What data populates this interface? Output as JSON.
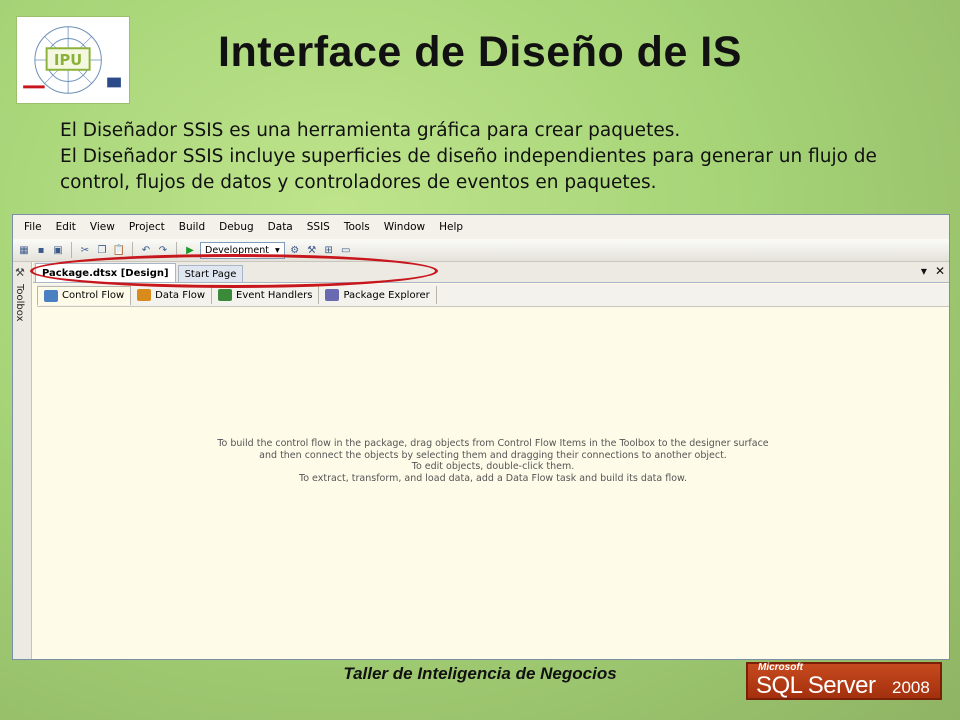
{
  "slide": {
    "title": "Interface de Diseño de IS",
    "description": [
      "El Diseñador SSIS es una herramienta gráfica para crear paquetes.",
      "El Diseñador SSIS incluye superficies de diseño independientes para generar un flujo de control, flujos de datos y controladores de eventos en paquetes."
    ],
    "footer": "Taller de Inteligencia de Negocios",
    "logo_text": "IPU"
  },
  "menu": [
    "File",
    "Edit",
    "View",
    "Project",
    "Build",
    "Debug",
    "Data",
    "SSIS",
    "Tools",
    "Window",
    "Help"
  ],
  "toolbar": {
    "configuration": "Development",
    "icons": [
      "new-project-icon",
      "save-icon",
      "save-all-icon",
      "cut-icon",
      "copy-icon",
      "paste-icon",
      "undo-icon",
      "redo-icon",
      "start-icon",
      "properties-icon",
      "toolbox-icon",
      "object-browser-icon",
      "command-window-icon"
    ]
  },
  "toolbox": {
    "label": "Toolbox"
  },
  "doc_tabs": [
    {
      "label": "Package.dtsx [Design]",
      "active": true
    },
    {
      "label": "Start Page",
      "active": false
    }
  ],
  "designer_tabs": [
    {
      "label": "Control Flow",
      "active": true,
      "color": "#4a7fc1"
    },
    {
      "label": "Data Flow",
      "active": false,
      "color": "#d98a1c"
    },
    {
      "label": "Event Handlers",
      "active": false,
      "color": "#3a8a3a"
    },
    {
      "label": "Package Explorer",
      "active": false,
      "color": "#6a6ab0"
    }
  ],
  "surface_hint": [
    "To build the control flow in the package, drag objects from Control Flow Items in the Toolbox to the designer surface",
    "and then connect the objects by selecting them and dragging their connections to another object.",
    "To edit objects, double-click them.",
    "To extract, transform, and load data, add a Data Flow task and build its data flow."
  ],
  "sql_logo": {
    "brand": "Microsoft",
    "product": "SQL Server",
    "year": "2008"
  },
  "colors": {
    "highlight": "#c8161d",
    "surface": "#fffbe9",
    "slide_bg": "#a6d477"
  }
}
